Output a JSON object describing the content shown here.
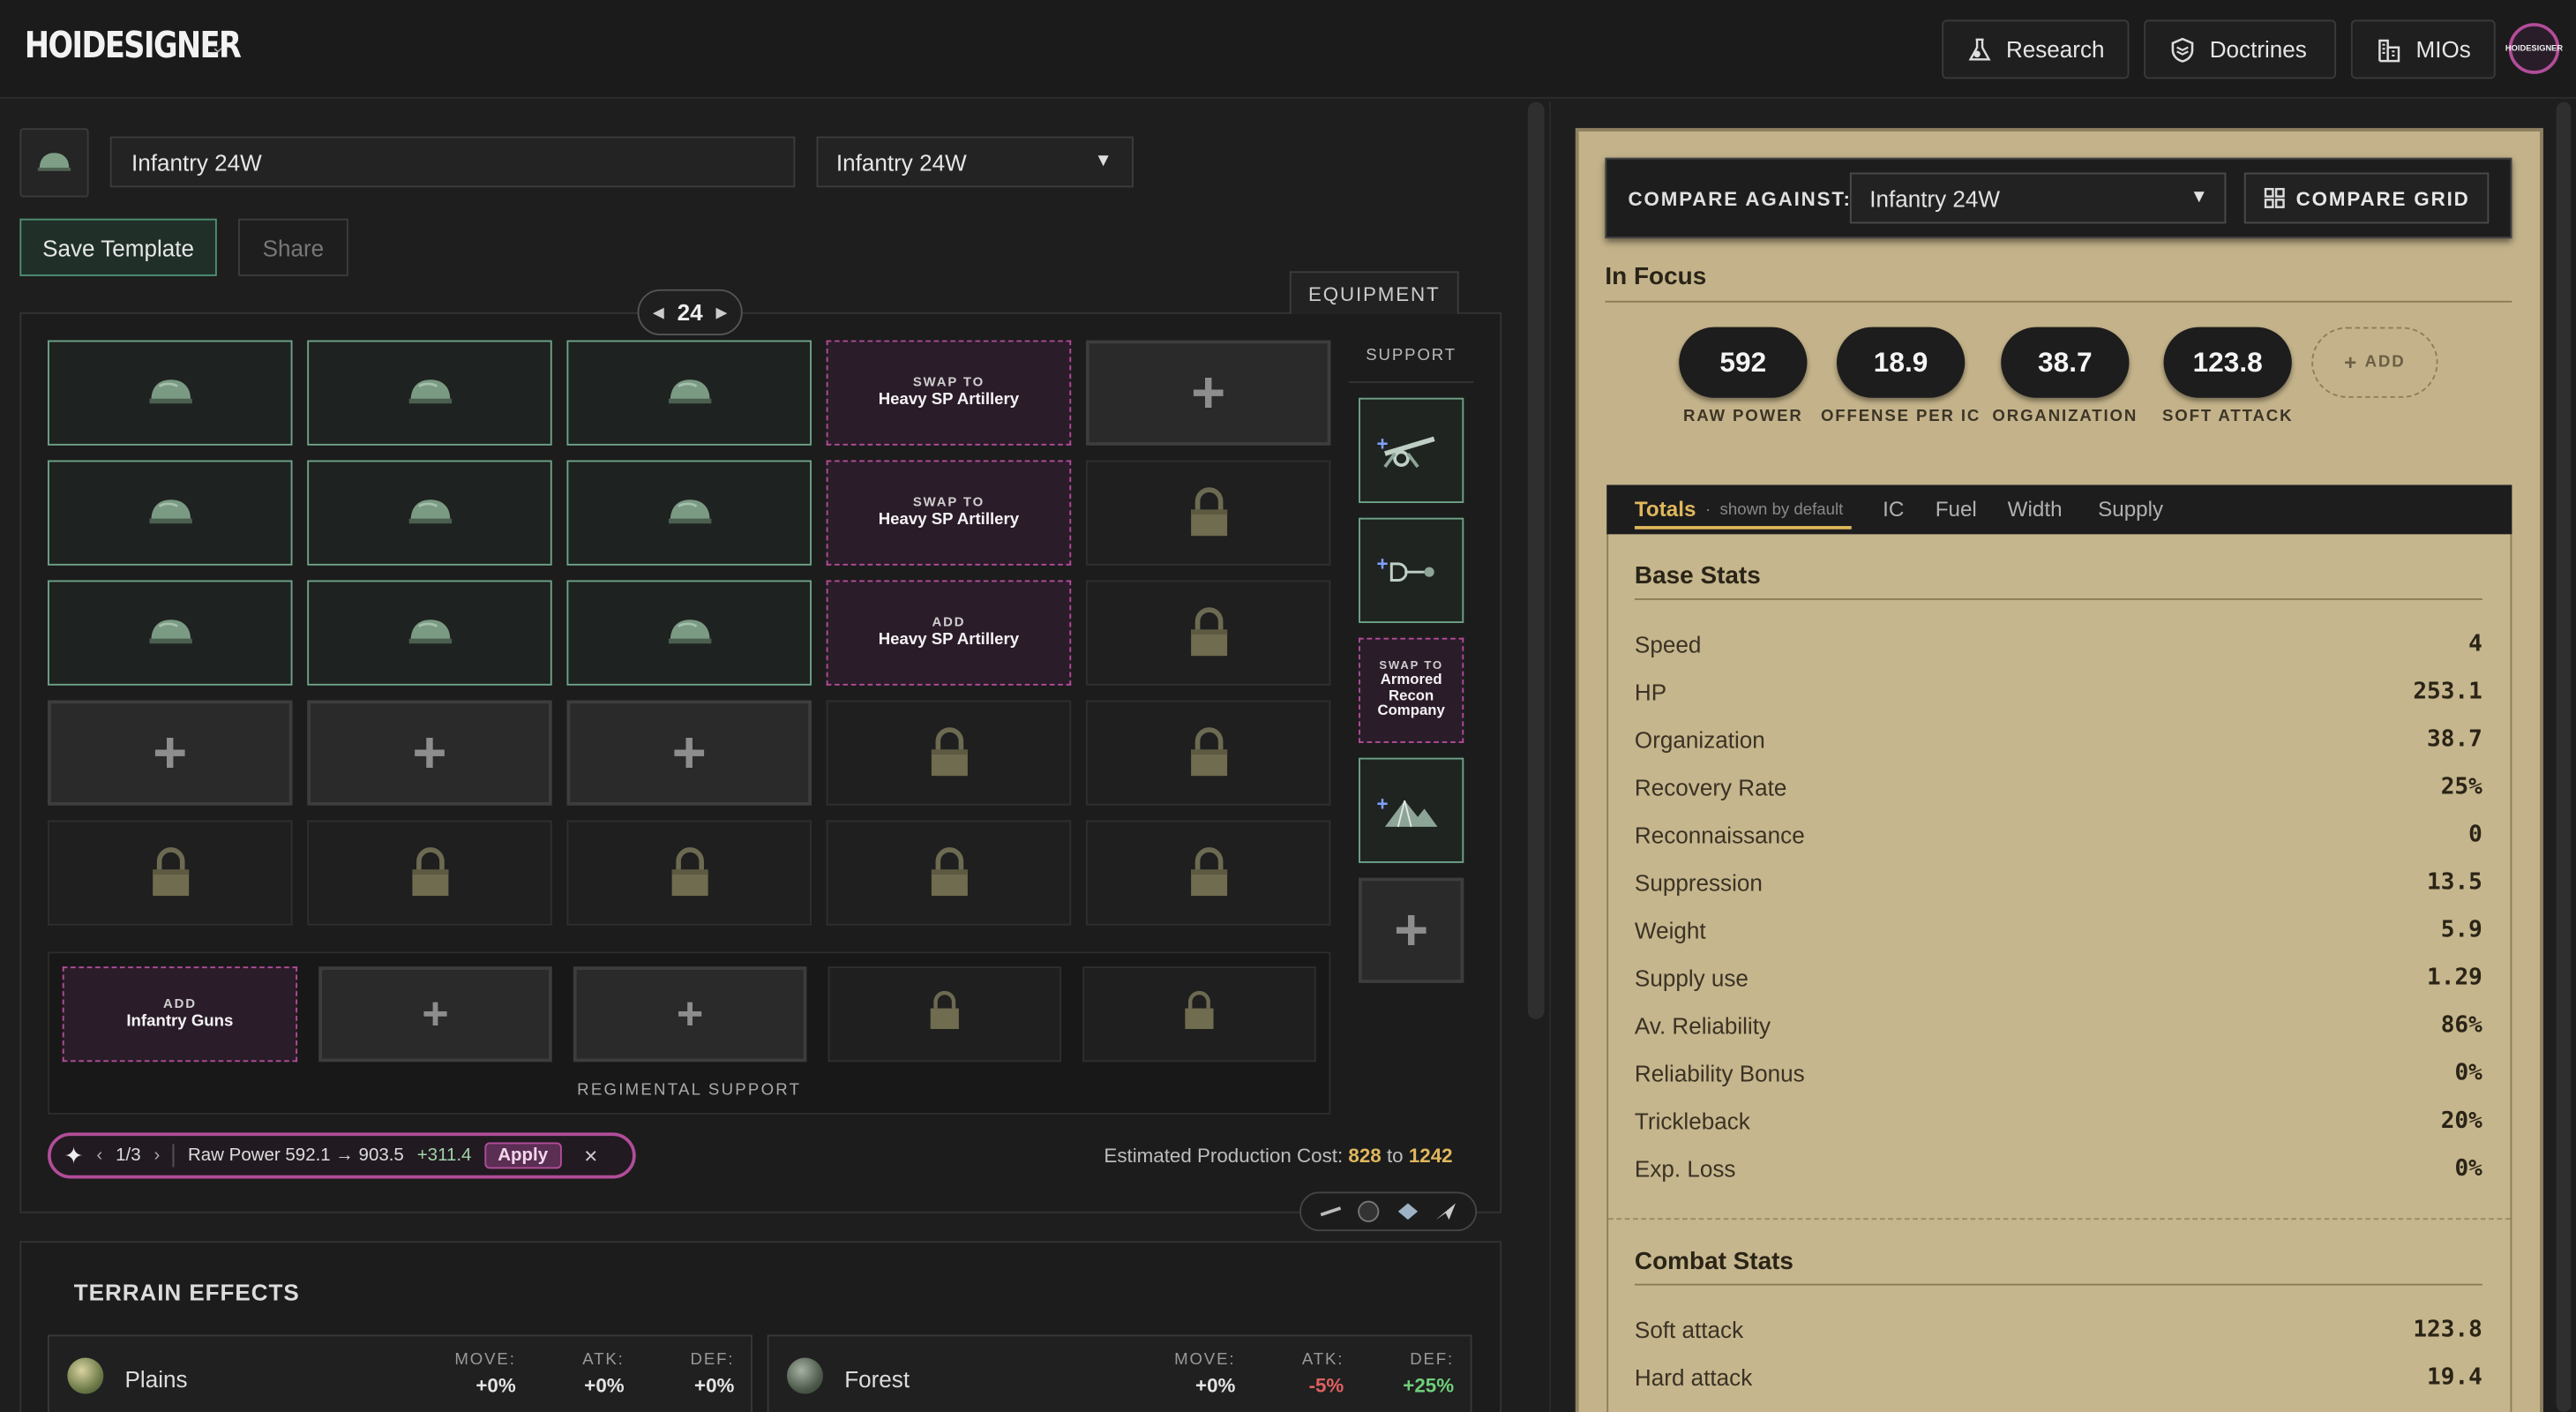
{
  "app": {
    "brand": "HOIDESIGNER",
    "avatar_text": "HOIDESIGNER"
  },
  "nav": {
    "research": "Research",
    "doctrines": "Doctrines",
    "mios": "MIOs"
  },
  "editor": {
    "division_name": "Infantry 24W",
    "template_select": "Infantry 24W",
    "save_label": "Save Template",
    "share_label": "Share",
    "equipment_tab": "EQUIPMENT",
    "width": "24",
    "support_label": "SUPPORT",
    "regimental_label": "REGIMENTAL SUPPORT",
    "suggestions": {
      "swap1_tag": "SWAP TO",
      "swap1_name": "Heavy SP Artillery",
      "swap2_tag": "SWAP TO",
      "swap2_name": "Heavy SP Artillery",
      "add1_tag": "ADD",
      "add1_name": "Heavy SP Artillery",
      "support_tag": "SWAP TO",
      "support_name": "Armored Recon Company",
      "reg_tag": "ADD",
      "reg_name": "Infantry Guns"
    },
    "suggest_bar": {
      "page": "1/3",
      "text": "Raw Power 592.1 → 903.5",
      "delta": "+311.4",
      "apply": "Apply",
      "close": "×"
    },
    "cost": {
      "prefix": "Estimated Production Cost:",
      "low": "828",
      "to": "to",
      "high": "1242"
    }
  },
  "terrain": {
    "title": "TERRAIN EFFECTS",
    "headers": {
      "move": "MOVE:",
      "atk": "ATK:",
      "def": "DEF:"
    },
    "rows": [
      {
        "name": "Plains",
        "move": "+0%",
        "atk": "+0%",
        "def": "+0%"
      },
      {
        "name": "Forest",
        "move": "+0%",
        "atk": "-5%",
        "def": "+25%"
      }
    ]
  },
  "compare": {
    "label": "COMPARE AGAINST:",
    "selected": "Infantry 24W",
    "grid_label": "COMPARE GRID"
  },
  "focus": {
    "title": "In Focus",
    "stats": [
      {
        "value": "592",
        "label": "RAW POWER"
      },
      {
        "value": "18.9",
        "label": "OFFENSE PER IC"
      },
      {
        "value": "38.7",
        "label": "ORGANIZATION"
      },
      {
        "value": "123.8",
        "label": "SOFT ATTACK"
      }
    ],
    "add_label": "ADD"
  },
  "tabs": {
    "totals": "Totals",
    "note": "shown by default",
    "ic": "IC",
    "fuel": "Fuel",
    "width": "Width",
    "supply": "Supply"
  },
  "base_stats": {
    "title": "Base Stats",
    "rows": [
      {
        "label": "Speed",
        "value": "4"
      },
      {
        "label": "HP",
        "value": "253.1"
      },
      {
        "label": "Organization",
        "value": "38.7"
      },
      {
        "label": "Recovery Rate",
        "value": "25%"
      },
      {
        "label": "Reconnaissance",
        "value": "0"
      },
      {
        "label": "Suppression",
        "value": "13.5"
      },
      {
        "label": "Weight",
        "value": "5.9"
      },
      {
        "label": "Supply use",
        "value": "1.29"
      },
      {
        "label": "Av. Reliability",
        "value": "86%"
      },
      {
        "label": "Reliability Bonus",
        "value": "0%"
      },
      {
        "label": "Trickleback",
        "value": "20%"
      },
      {
        "label": "Exp. Loss",
        "value": "0%"
      }
    ]
  },
  "combat_stats": {
    "title": "Combat Stats",
    "rows": [
      {
        "label": "Soft attack",
        "value": "123.8"
      },
      {
        "label": "Hard attack",
        "value": "19.4"
      }
    ]
  },
  "colors": {
    "accent_gold": "#e0b75c",
    "suggest_pink": "#b24d99",
    "infantry_green": "#6ea589",
    "parchment": "#c4b38a"
  }
}
